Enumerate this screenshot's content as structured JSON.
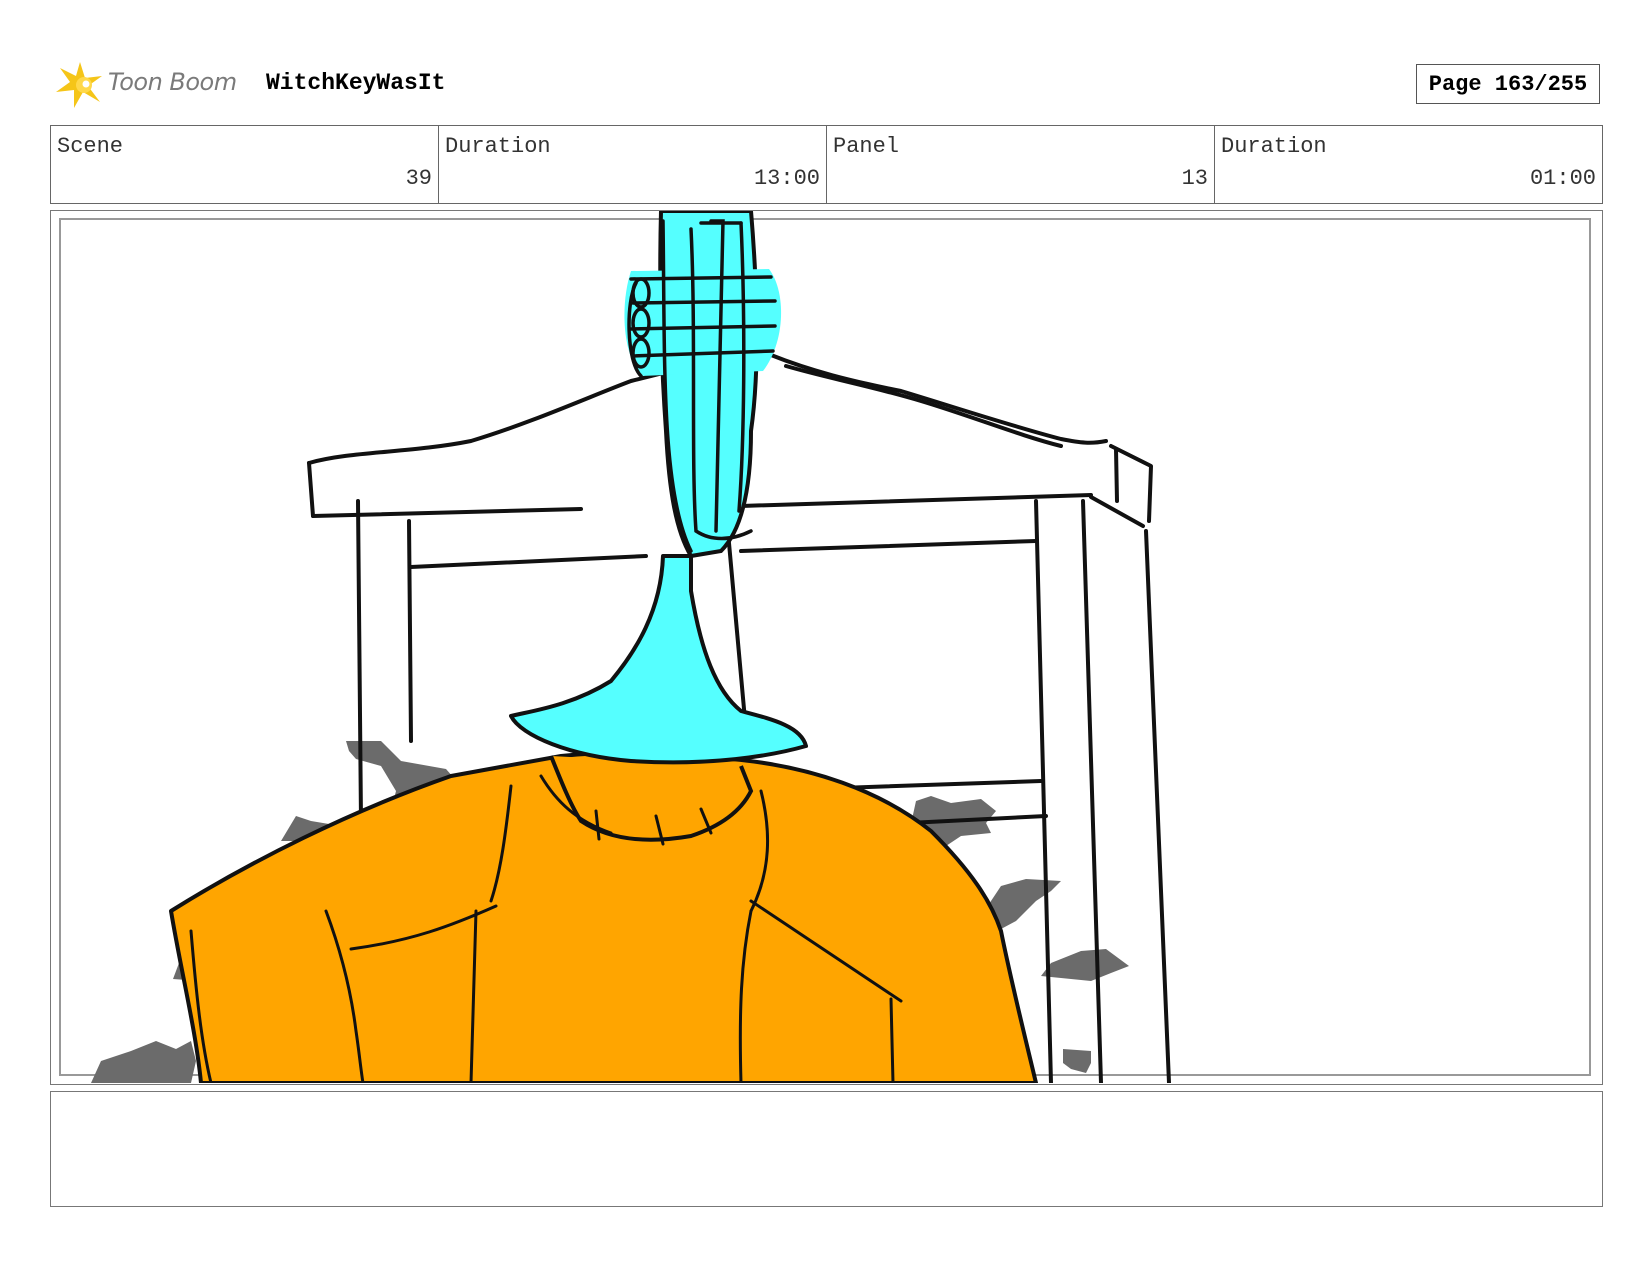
{
  "header": {
    "brand": "Toon Boom",
    "project_title": "WitchKeyWasIt",
    "page_label": "Page 163/255"
  },
  "info": {
    "scene_label": "Scene",
    "scene_value": "39",
    "scene_duration_label": "Duration",
    "scene_duration_value": "13:00",
    "panel_label": "Panel",
    "panel_value": "13",
    "panel_duration_label": "Duration",
    "panel_duration_value": "01:00"
  },
  "colors": {
    "sweater": "#FFA500",
    "instrument": "#55FFFF",
    "debris": "#6B6B6B",
    "logo_accent": "#F5C518"
  },
  "notes": {
    "text": ""
  }
}
